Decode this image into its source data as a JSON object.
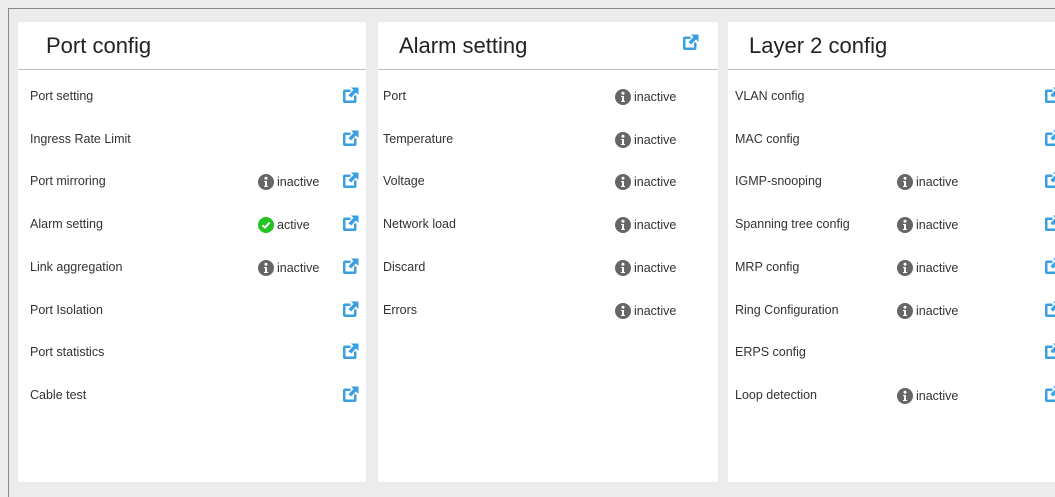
{
  "colors": {
    "accent": "#3a9fe0",
    "active": "#22c322",
    "inactive_icon": "#666666",
    "panel_bg": "#ffffff",
    "page_bg": "#ececec"
  },
  "icons": {
    "external": "external-link-icon",
    "inactive": "info-circle-icon",
    "active": "check-circle-icon"
  },
  "port_config": {
    "title": "Port config",
    "rows": [
      {
        "label": "Port setting"
      },
      {
        "label": "Ingress Rate Limit"
      },
      {
        "label": "Port mirroring",
        "status": "inactive"
      },
      {
        "label": "Alarm setting",
        "status": "active"
      },
      {
        "label": "Link aggregation",
        "status": "inactive"
      },
      {
        "label": "Port Isolation"
      },
      {
        "label": "Port statistics"
      },
      {
        "label": "Cable test"
      }
    ]
  },
  "alarm_setting": {
    "title": "Alarm setting",
    "rows": [
      {
        "label": "Port",
        "status": "inactive"
      },
      {
        "label": "Temperature",
        "status": "inactive"
      },
      {
        "label": "Voltage",
        "status": "inactive"
      },
      {
        "label": "Network load",
        "status": "inactive"
      },
      {
        "label": "Discard",
        "status": "inactive"
      },
      {
        "label": "Errors",
        "status": "inactive"
      }
    ]
  },
  "layer2_config": {
    "title": "Layer 2 config",
    "rows": [
      {
        "label": "VLAN config"
      },
      {
        "label": "MAC config"
      },
      {
        "label": "IGMP-snooping",
        "status": "inactive"
      },
      {
        "label": "Spanning tree config",
        "status": "inactive"
      },
      {
        "label": "MRP config",
        "status": "inactive"
      },
      {
        "label": "Ring Configuration",
        "status": "inactive"
      },
      {
        "label": "ERPS config"
      },
      {
        "label": "Loop detection",
        "status": "inactive"
      }
    ]
  }
}
